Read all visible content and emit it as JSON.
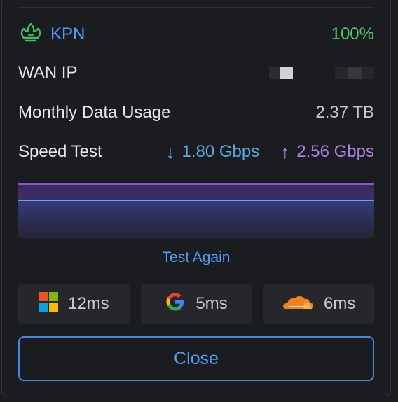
{
  "isp": {
    "name": "KPN",
    "signal": "100%",
    "icon": "kpn-crown-icon",
    "name_color": "#4d9ef6",
    "signal_color": "#4ccb6b"
  },
  "wan": {
    "label": "WAN IP"
  },
  "usage": {
    "label": "Monthly Data Usage",
    "value": "2.37 TB"
  },
  "speed": {
    "label": "Speed Test",
    "download": "1.80 Gbps",
    "upload": "2.56 Gbps",
    "download_color": "#58a9e6",
    "upload_color": "#a883dc"
  },
  "actions": {
    "test_again": "Test Again",
    "close": "Close"
  },
  "pings": [
    {
      "provider_icon": "microsoft-icon",
      "value": "12ms"
    },
    {
      "provider_icon": "google-icon",
      "value": "5ms"
    },
    {
      "provider_icon": "cloudflare-icon",
      "value": "6ms"
    }
  ]
}
